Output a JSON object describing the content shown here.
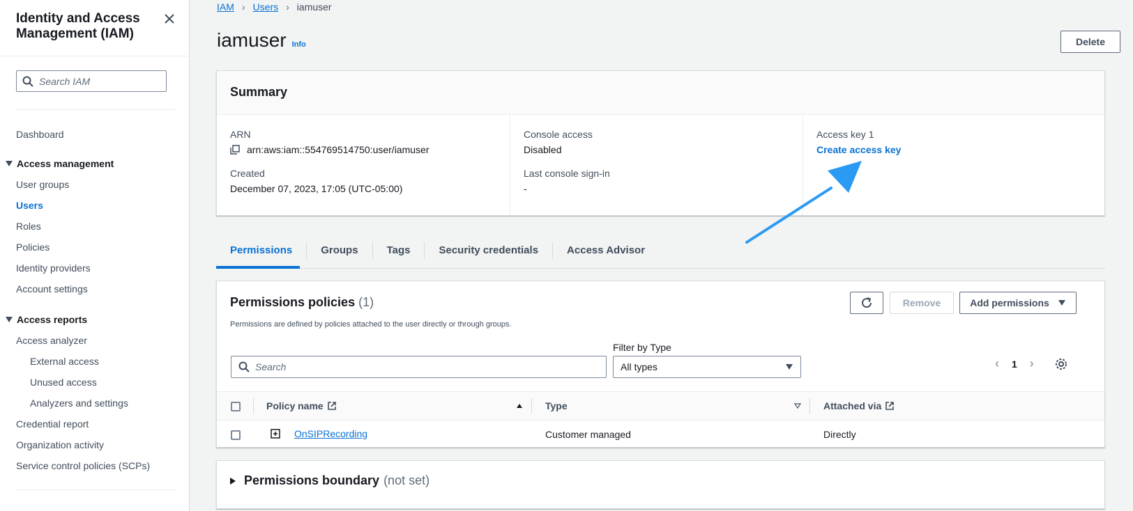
{
  "sidebar": {
    "title": "Identity and Access Management (IAM)",
    "search_placeholder": "Search IAM",
    "items": {
      "dashboard": "Dashboard",
      "access_management": "Access management",
      "user_groups": "User groups",
      "users": "Users",
      "roles": "Roles",
      "policies": "Policies",
      "identity_providers": "Identity providers",
      "account_settings": "Account settings",
      "access_reports": "Access reports",
      "access_analyzer": "Access analyzer",
      "external_access": "External access",
      "unused_access": "Unused access",
      "analyzers_settings": "Analyzers and settings",
      "credential_report": "Credential report",
      "organization_activity": "Organization activity",
      "scps": "Service control policies (SCPs)"
    },
    "active": "Users"
  },
  "breadcrumb": {
    "iam": "IAM",
    "users": "Users",
    "current": "iamuser"
  },
  "page": {
    "title": "iamuser",
    "info": "Info",
    "delete_label": "Delete"
  },
  "summary": {
    "title": "Summary",
    "arn_label": "ARN",
    "arn_value": "arn:aws:iam::554769514750:user/iamuser",
    "created_label": "Created",
    "created_value": "December 07, 2023, 17:05 (UTC-05:00)",
    "console_access_label": "Console access",
    "console_access_value": "Disabled",
    "last_signin_label": "Last console sign-in",
    "last_signin_value": "-",
    "access_key_label": "Access key 1",
    "create_access_key": "Create access key"
  },
  "tabs": [
    "Permissions",
    "Groups",
    "Tags",
    "Security credentials",
    "Access Advisor"
  ],
  "permissions": {
    "title": "Permissions policies",
    "count": "(1)",
    "description": "Permissions are defined by policies attached to the user directly or through groups.",
    "remove_label": "Remove",
    "add_permissions_label": "Add permissions",
    "filter_label": "Filter by Type",
    "search_placeholder": "Search",
    "filter_value": "All types",
    "page": "1",
    "columns": {
      "policy_name": "Policy name",
      "type": "Type",
      "attached_via": "Attached via"
    },
    "rows": [
      {
        "policy_name": "OnSIPRecording",
        "type": "Customer managed",
        "attached_via": "Directly"
      }
    ]
  },
  "boundary": {
    "title": "Permissions boundary",
    "status": "(not set)"
  },
  "colors": {
    "accent": "#0972d3",
    "arrow": "#2b9af3"
  }
}
